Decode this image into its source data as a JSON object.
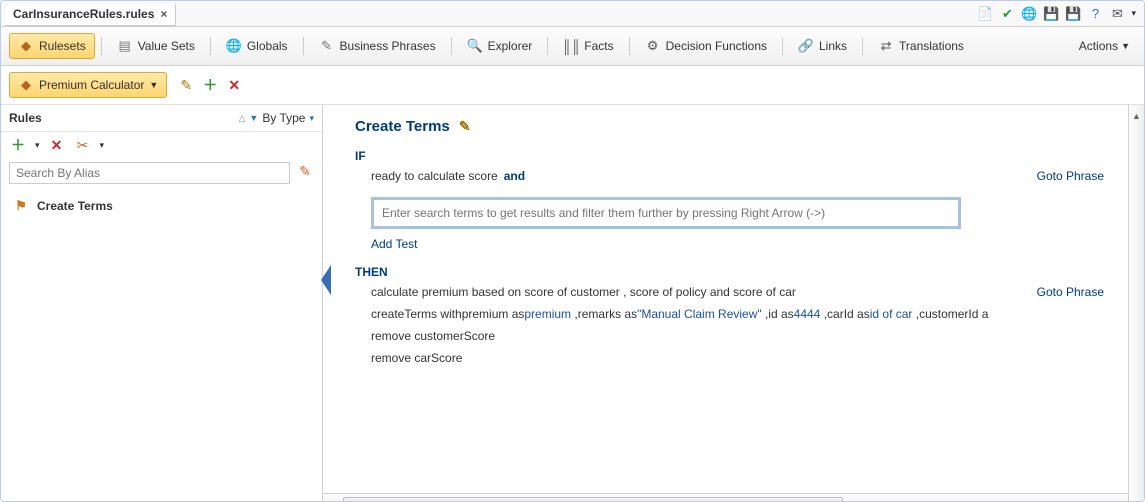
{
  "file_tab": {
    "title": "CarInsuranceRules.rules"
  },
  "top_icons": [
    {
      "name": "doc-icon",
      "glyph": "📄",
      "color": "#2d6fb7"
    },
    {
      "name": "check-icon",
      "glyph": "✔",
      "color": "#2c9a2c"
    },
    {
      "name": "globe-icon",
      "glyph": "🌐",
      "color": "#2d6fb7"
    },
    {
      "name": "save-icon",
      "glyph": "💾",
      "color": "#4b4bb3"
    },
    {
      "name": "saveall-icon",
      "glyph": "💾",
      "color": "#7a4bb3"
    },
    {
      "name": "help-icon",
      "glyph": "?",
      "color": "#2d6fb7"
    },
    {
      "name": "mail-icon",
      "glyph": "✉",
      "color": "#555"
    }
  ],
  "modules": {
    "rulesets": "Rulesets",
    "valuesets": "Value Sets",
    "globals": "Globals",
    "phrases": "Business Phrases",
    "explorer": "Explorer",
    "facts": "Facts",
    "decisionfns": "Decision Functions",
    "links": "Links",
    "translations": "Translations"
  },
  "actions_label": "Actions",
  "ruleset_select": "Premium Calculator",
  "rules_panel": {
    "title": "Rules",
    "sort": "By Type",
    "search_placeholder": "Search By Alias",
    "items": [
      {
        "label": "Create Terms"
      }
    ]
  },
  "editor": {
    "title": "Create Terms",
    "if_label": "IF",
    "condition": "ready to calculate score",
    "and": "and",
    "goto": "Goto Phrase",
    "search_placeholder": "Enter search terms to get results and filter them further by pressing Right Arrow (->)",
    "add_test": "Add Test",
    "then_label": "THEN",
    "then_line1": "calculate premium based on score of customer , score of policy and score of car",
    "then_line2_pre": "createTerms withpremium as",
    "then_line2_v1": "premium",
    "then_line2_mid1": " ,remarks as",
    "then_line2_v2": "\"Manual Claim Review\"",
    "then_line2_mid2": " ,id as",
    "then_line2_v3": "4444",
    "then_line2_mid3": " ,carId as",
    "then_line2_v4": "id of car",
    "then_line2_tail": " ,customerId a",
    "then_line3": "remove customerScore",
    "then_line4": "remove carScore"
  }
}
